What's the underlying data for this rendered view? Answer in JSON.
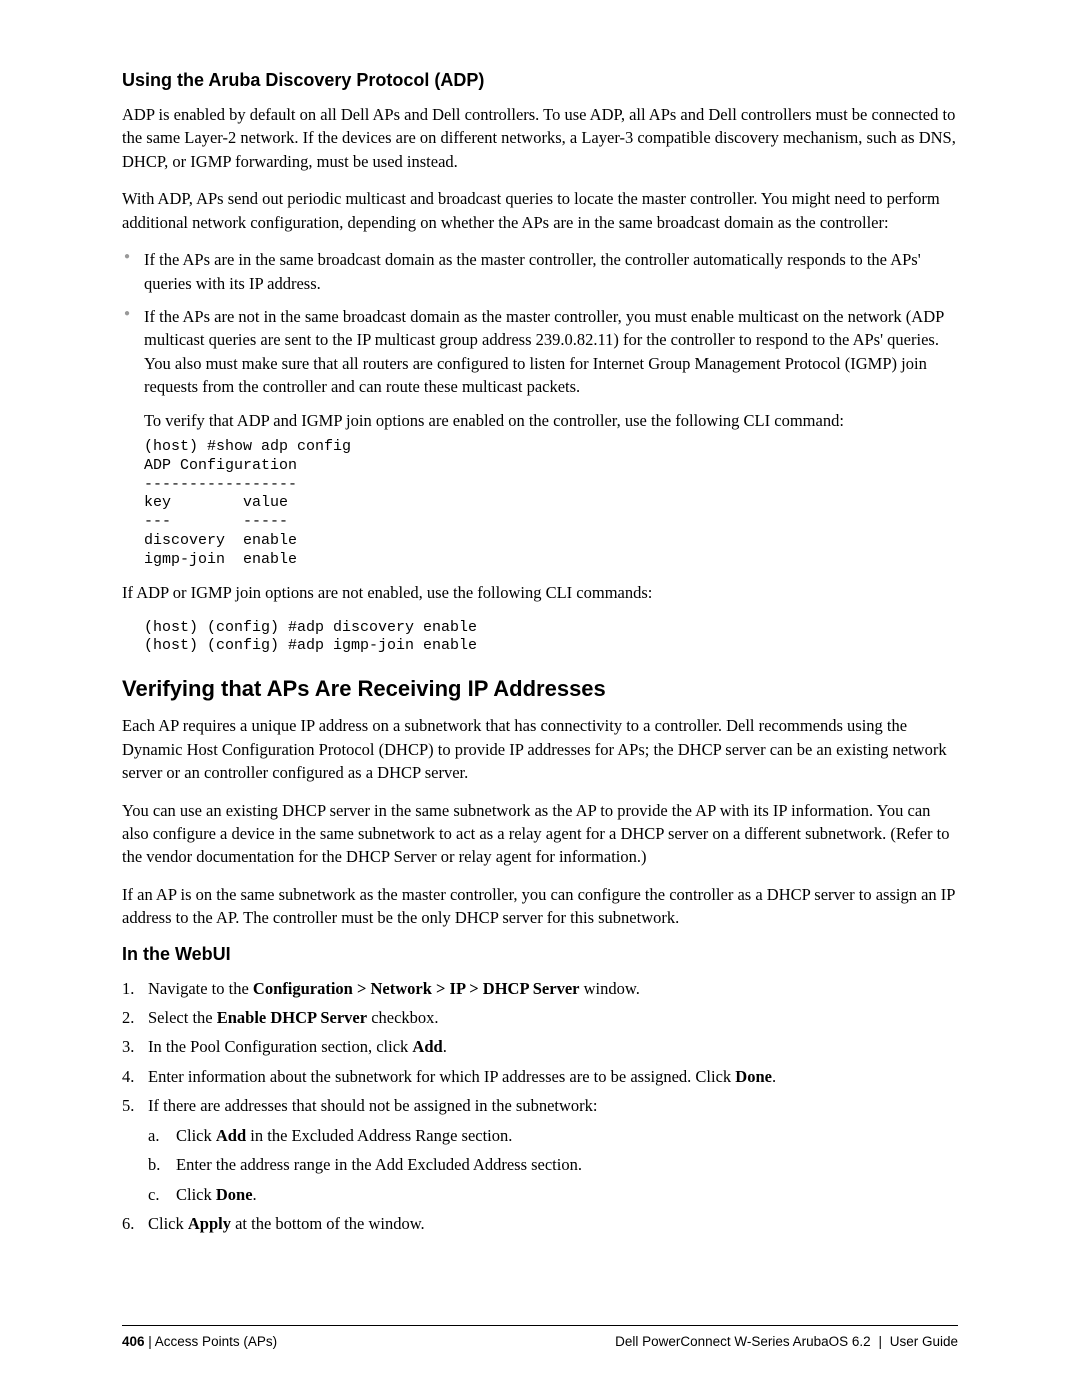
{
  "s1": {
    "heading": "Using the Aruba Discovery Protocol (ADP)",
    "p1": "ADP is enabled by default on all Dell APs and Dell controllers. To use ADP, all APs and Dell controllers must be connected to the same Layer-2 network. If the devices are on different networks, a Layer-3 compatible discovery mechanism, such as DNS, DHCP, or IGMP forwarding, must be used instead.",
    "p2": "With ADP, APs send out periodic multicast and broadcast queries to locate the master controller. You might need to perform additional network configuration, depending on whether the APs are in the same broadcast domain as the controller:",
    "b1": "If the APs are in the same broadcast domain as the master controller, the controller automatically responds to the APs' queries with its IP address.",
    "b2": "If the APs are not in the same broadcast domain as the master controller, you must enable multicast on the network (ADP multicast queries are sent to the IP multicast group address 239.0.82.11) for the controller to respond to the APs' queries. You also must make sure that all routers are configured to listen for Internet Group Management Protocol (IGMP) join requests from the controller and can route these multicast packets.",
    "inner": "To verify that ADP and IGMP join options are enabled on the controller, use the following CLI command:",
    "cli1": "(host) #show adp config\nADP Configuration\n-----------------\nkey        value\n---        -----\ndiscovery  enable\nigmp-join  enable",
    "p3": "If ADP or IGMP join options are not enabled, use the following CLI commands:",
    "cli2": "(host) (config) #adp discovery enable\n(host) (config) #adp igmp-join enable"
  },
  "s2": {
    "heading": "Verifying that APs Are Receiving IP Addresses",
    "p1": "Each AP requires a unique IP address on a subnetwork that has connectivity to a controller. Dell recommends using the Dynamic Host Configuration Protocol (DHCP) to provide IP addresses for APs; the DHCP server can be an existing network server or an controller configured as a DHCP server.",
    "p2": "You can use an existing DHCP server in the same subnetwork as the AP to provide the AP with its IP information. You can also configure a device in the same subnetwork to act as a relay agent for a DHCP server on a different subnetwork. (Refer to the vendor documentation for the DHCP Server or relay agent for information.)",
    "p3": "If an AP is on the same subnetwork as the master controller, you can configure the controller as a DHCP server to assign an IP address to the AP. The controller must be the only DHCP server for this subnetwork.",
    "subhead": "In the WebUI",
    "steps": {
      "s1_pre": "Navigate to the ",
      "s1_b": "Configuration > Network > IP > DHCP Server",
      "s1_post": " window.",
      "s2_pre": "Select the ",
      "s2_b": "Enable DHCP Server",
      "s2_post": " checkbox.",
      "s3_pre": "In the Pool Configuration section, click ",
      "s3_b": "Add",
      "s3_post": ".",
      "s4_pre": "Enter information about the subnetwork for which IP addresses are to be assigned. Click ",
      "s4_b": "Done",
      "s4_post": ".",
      "s5": "If there are addresses that should not be assigned in the subnetwork:",
      "s5a_pre": "Click ",
      "s5a_b": "Add",
      "s5a_post": " in the Excluded Address Range section.",
      "s5b": "Enter the address range in the Add Excluded Address section.",
      "s5c_pre": "Click ",
      "s5c_b": "Done",
      "s5c_post": ".",
      "s6_pre": "Click ",
      "s6_b": "Apply",
      "s6_post": " at the bottom of the window."
    }
  },
  "footer": {
    "pagenum": "406",
    "sep1": " | ",
    "section": "Access Points (APs)",
    "product": "Dell PowerConnect W-Series ArubaOS 6.2",
    "sep2": "  |  ",
    "doc": "User Guide"
  }
}
